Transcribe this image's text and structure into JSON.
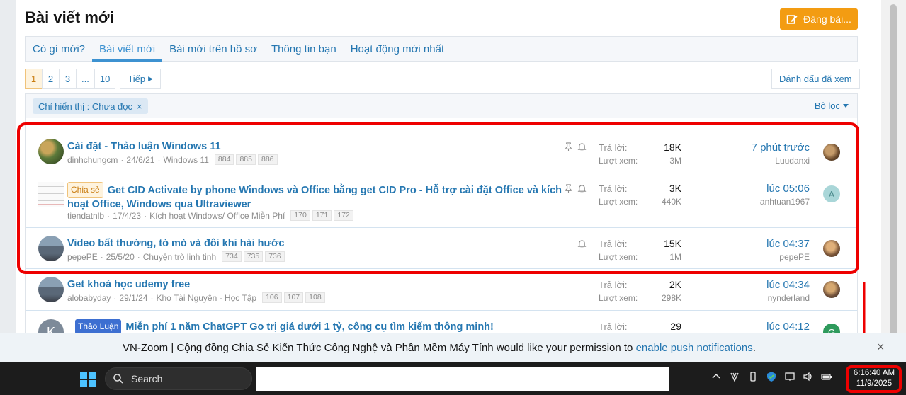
{
  "header": {
    "title": "Bài viết mới",
    "post_button": "Đăng bài..."
  },
  "tabs": [
    {
      "label": "Có gì mới?"
    },
    {
      "label": "Bài viết mới",
      "active": true
    },
    {
      "label": "Bài mới trên hồ sơ"
    },
    {
      "label": "Thông tin bạn"
    },
    {
      "label": "Hoạt động mới nhất"
    }
  ],
  "pager": {
    "pages": [
      "1",
      "2",
      "3",
      "...",
      "10"
    ],
    "current": "1",
    "next": "Tiếp",
    "mark_read": "Đánh dấu đã xem"
  },
  "filter": {
    "chip": "Chỉ hiển thị : Chưa đọc",
    "button": "Bộ lọc"
  },
  "labels": {
    "replies": "Trả lời:",
    "views": "Lượt xem:"
  },
  "threads": [
    {
      "title": "Cài đặt - Thảo luận Windows 11",
      "author": "dinhchungcm",
      "date": "24/6/21",
      "forum": "Windows 11",
      "pages": [
        "884",
        "885",
        "886"
      ],
      "replies": "18K",
      "views": "3M",
      "last_time": "7 phút trước",
      "last_user": "Luudanxi",
      "pinned": true,
      "watched": true
    },
    {
      "prefix": "Chia sẻ",
      "title": "Get CID Activate by phone Windows và Office bằng get CID Pro - Hỗ trợ cài đặt Office và kích hoạt Office, Windows qua Ultraviewer",
      "author": "tiendatnlb",
      "date": "17/4/23",
      "forum": "Kích hoạt Windows/ Office Miễn Phí",
      "pages": [
        "170",
        "171",
        "172"
      ],
      "replies": "3K",
      "views": "440K",
      "last_time": "lúc 05:06",
      "last_user": "anhtuan1967",
      "last_avatar_letter": "A",
      "pinned": true,
      "watched": true
    },
    {
      "title": "Video bất thường, tò mò và đôi khi hài hước",
      "author": "pepePE",
      "date": "25/5/20",
      "forum": "Chuyện trò linh tinh",
      "pages": [
        "734",
        "735",
        "736"
      ],
      "replies": "15K",
      "views": "1M",
      "last_time": "lúc 04:37",
      "last_user": "pepePE",
      "watched": true
    },
    {
      "title": "Get khoá học udemy free",
      "author": "alobabyday",
      "date": "29/1/24",
      "forum": "Kho Tài Nguyên - Học Tập",
      "pages": [
        "106",
        "107",
        "108"
      ],
      "replies": "2K",
      "views": "298K",
      "last_time": "lúc 04:34",
      "last_user": "nynderland"
    },
    {
      "prefix": "Thảo Luận",
      "title": "Miễn phí 1 năm ChatGPT Go trị giá dưới 1 tỷ, công cụ tìm kiếm thông minh!",
      "replies": "29",
      "last_time": "lúc 04:12",
      "avatar_letter": "K",
      "last_avatar_letter": "G"
    }
  ],
  "notification": {
    "text": "VN-Zoom | Cộng đồng Chia Sẻ Kiến Thức Công Nghệ và Phần Mềm Máy Tính would like your permission to ",
    "link": "enable push notifications",
    "suffix": ".",
    "close": "×"
  },
  "taskbar": {
    "search_placeholder": "Search",
    "time": "6:16:40 AM",
    "date": "11/9/2025"
  },
  "colors": {
    "accent": "#2577b1",
    "button": "#f39c12",
    "highlight": "#e00000"
  }
}
